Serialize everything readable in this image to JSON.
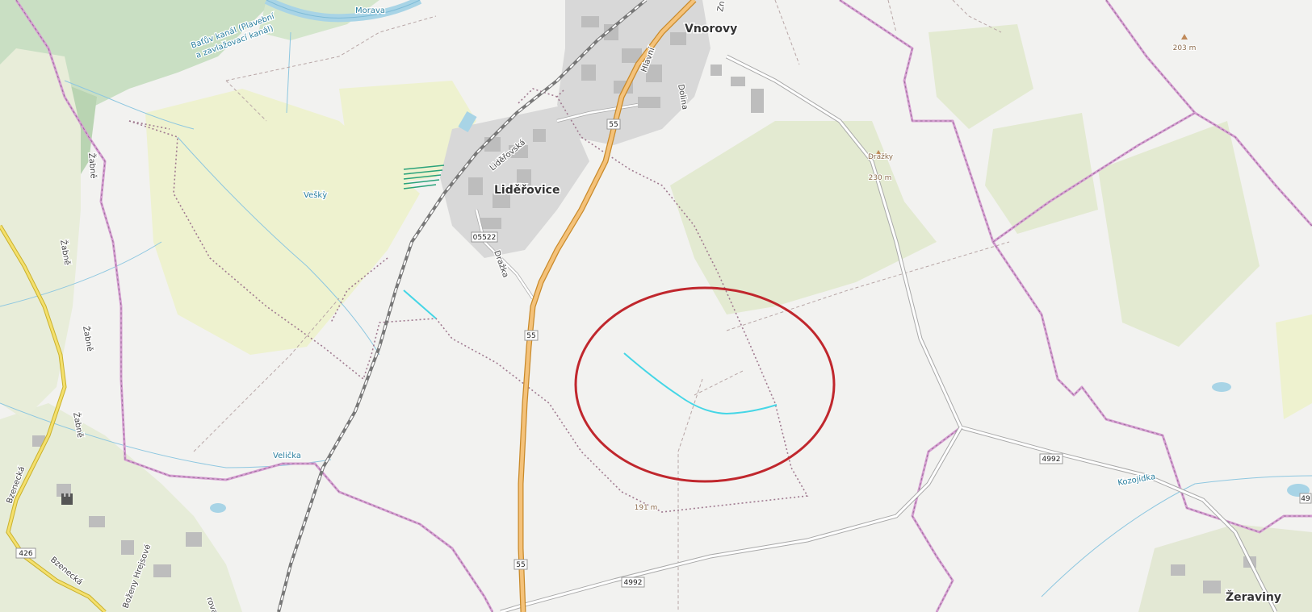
{
  "map": {
    "places": {
      "vnorovy": "Vnorovy",
      "liderovice": "Liděřovice",
      "zeraviny": "Žeraviny"
    },
    "streets": {
      "hlavni": "Hlavní",
      "dolina": "Dolina",
      "zn": "Zn",
      "liderovska": "Liděřovská",
      "drazka": "Dražka",
      "zabne1": "Žabně",
      "zabne2": "Žabně",
      "zabne3": "Žabně",
      "zabne4": "Žabně",
      "bzenecka1": "Bzenecká",
      "bzenecka2": "Bzenecká",
      "bozeny": "Boženy Hrejsové",
      "ova": "rova"
    },
    "water": {
      "morava": "Morava",
      "batuv_line1": "Baťův kanál (Plavební",
      "batuv_line2": "a zavlažovací kanál)",
      "vesky": "Veškỳ",
      "velicka": "Velička",
      "kozojidka": "Kozojídka"
    },
    "peaks": {
      "drazky_name": "Dražky",
      "drazky_elev": "230 m",
      "p203": "203 m",
      "p191": "191 m"
    },
    "roads": {
      "r55a": "55",
      "r55b": "55",
      "r55c": "55",
      "r05522": "05522",
      "r4992a": "4992",
      "r4992b": "4992",
      "r426": "426",
      "r49": "49"
    },
    "highlight_color": "#c0272d",
    "stream_color": "#45d6e6"
  }
}
